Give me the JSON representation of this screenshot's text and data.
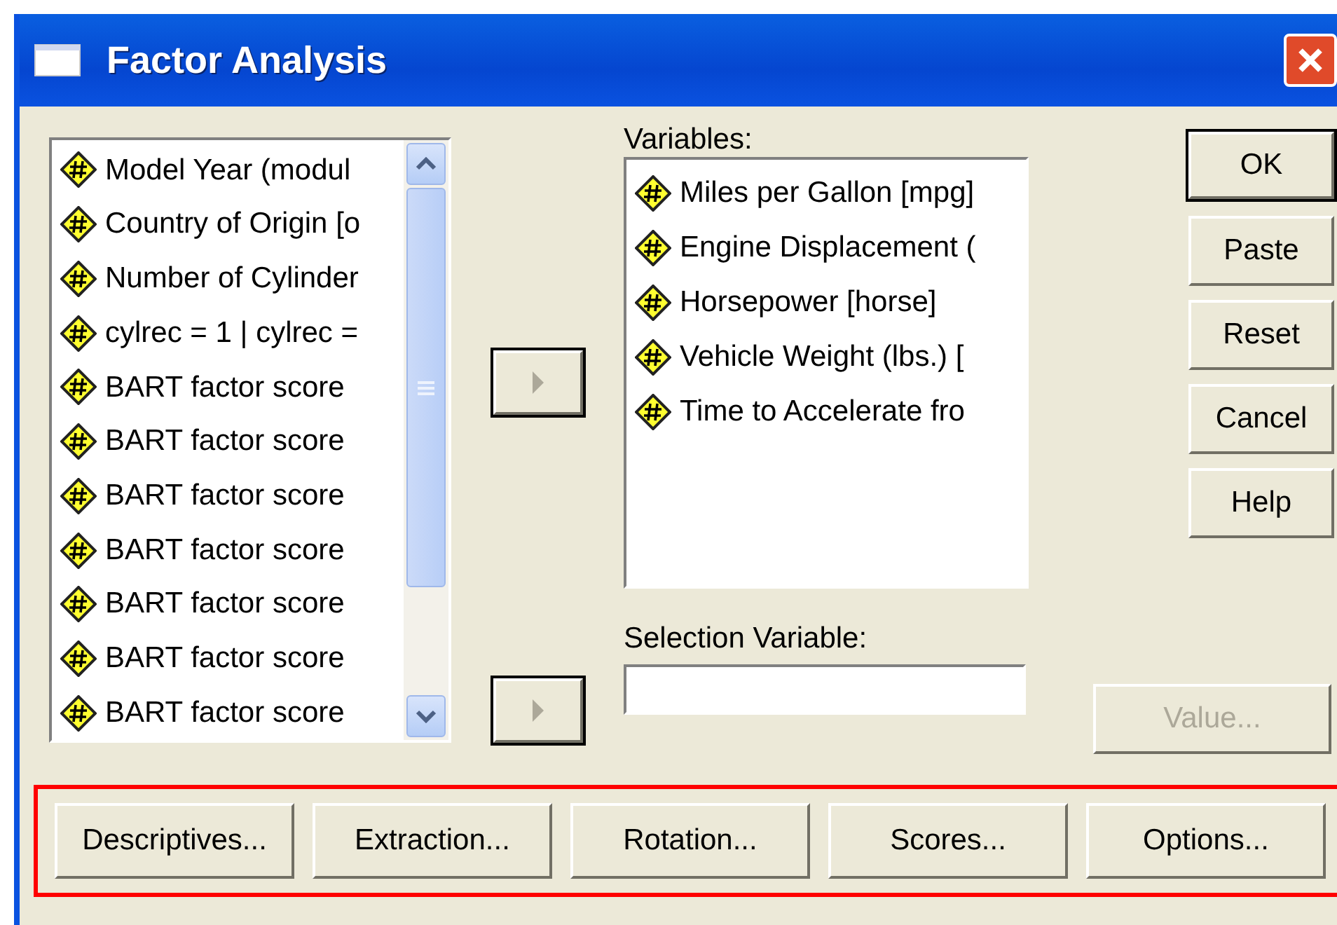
{
  "window": {
    "title": "Factor Analysis"
  },
  "source_list": {
    "items": [
      {
        "label": "Model Year (modul"
      },
      {
        "label": "Country of Origin [o"
      },
      {
        "label": "Number of Cylinder"
      },
      {
        "label": "cylrec = 1 | cylrec ="
      },
      {
        "label": "BART factor score"
      },
      {
        "label": "BART factor score"
      },
      {
        "label": "BART factor score"
      },
      {
        "label": "BART factor score"
      },
      {
        "label": "BART factor score"
      },
      {
        "label": "BART factor score"
      },
      {
        "label": "BART factor score"
      }
    ]
  },
  "variables": {
    "label": "Variables:",
    "items": [
      {
        "label": "Miles per Gallon [mpg]"
      },
      {
        "label": "Engine Displacement ("
      },
      {
        "label": "Horsepower [horse]"
      },
      {
        "label": "Vehicle Weight (lbs.) ["
      },
      {
        "label": "Time to Accelerate fro"
      }
    ]
  },
  "selection_variable": {
    "label": "Selection Variable:"
  },
  "side_buttons": [
    {
      "label": "OK",
      "default": true,
      "disabled": false
    },
    {
      "label": "Paste",
      "default": false,
      "disabled": false
    },
    {
      "label": "Reset",
      "default": false,
      "disabled": false
    },
    {
      "label": "Cancel",
      "default": false,
      "disabled": false
    },
    {
      "label": "Help",
      "default": false,
      "disabled": false
    }
  ],
  "value_button": {
    "label": "Value...",
    "disabled": true
  },
  "bottom_buttons": [
    {
      "label": "Descriptives..."
    },
    {
      "label": "Extraction..."
    },
    {
      "label": "Rotation..."
    },
    {
      "label": "Scores..."
    },
    {
      "label": "Options..."
    }
  ]
}
